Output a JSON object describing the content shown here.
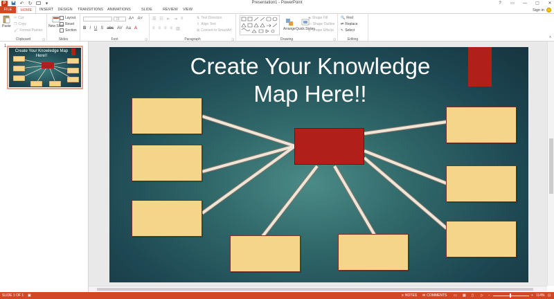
{
  "window": {
    "title": "Presentation1 - PowerPoint",
    "app_logo": "P"
  },
  "title_controls": [
    "?",
    "▭",
    "—",
    "▢",
    "✕"
  ],
  "tabs": [
    "FILE",
    "HOME",
    "INSERT",
    "DESIGN",
    "TRANSITIONS",
    "ANIMATIONS",
    "SLIDE SHOW",
    "REVIEW",
    "VIEW"
  ],
  "account": {
    "label": "Sign in"
  },
  "ribbon": {
    "clipboard": {
      "label": "Clipboard",
      "paste": "Paste",
      "cut": "Cut",
      "copy": "Copy",
      "format_painter": "Format Painter"
    },
    "slides": {
      "label": "Slides",
      "new_slide": "New Slide",
      "layout": "Layout",
      "reset": "Reset",
      "section": "Section"
    },
    "font": {
      "label": "Font",
      "size": "18"
    },
    "paragraph": {
      "label": "Paragraph",
      "text_direction": "Text Direction",
      "align_text": "Align Text",
      "smartart": "Convert to SmartArt"
    },
    "drawing": {
      "label": "Drawing",
      "arrange": "Arrange",
      "quick_styles": "Quick Styles",
      "shape_fill": "Shape Fill",
      "shape_outline": "Shape Outline",
      "shape_effects": "Shape Effects"
    },
    "editing": {
      "label": "Editing",
      "find": "Find",
      "replace": "Replace",
      "select": "Select"
    }
  },
  "slides_pane": {
    "slide_number": "1",
    "thumb_title": "Create Your Knowledge Map Here!!"
  },
  "slide": {
    "title": "Create Your Knowledge Map Here!!"
  },
  "status": {
    "slide_info": "SLIDE 1 OF 1",
    "notes": "NOTES",
    "comments": "COMMENTS",
    "zoom": "114%"
  },
  "colors": {
    "accent": "#d24726",
    "box_fill": "#f5d58a",
    "center_fill": "#b01f1a",
    "slide_bg": "#2f6668"
  }
}
